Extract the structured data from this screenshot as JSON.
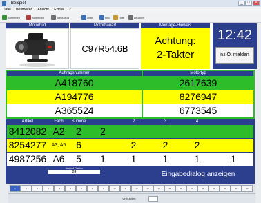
{
  "window": {
    "title": "Beispiel"
  },
  "menu": [
    "Datei",
    "Bearbeiten",
    "Ansicht",
    "Extras",
    "?"
  ],
  "toolbar": [
    {
      "label": "Anmelden",
      "icon": "login-icon",
      "color": "#3b8f3b"
    },
    {
      "label": "Abmelden",
      "icon": "logout-icon",
      "color": "#b23b3b"
    },
    {
      "label": "Werkzeug",
      "icon": "tool-icon",
      "color": "#6f6f6f"
    },
    {
      "label": "Liste",
      "icon": "list-icon",
      "color": "#3b6fb6"
    },
    {
      "label": "Info",
      "icon": "info-icon",
      "color": "#3b6fb6"
    },
    {
      "label": "Hilfe",
      "icon": "help-icon",
      "color": "#c69b2b"
    },
    {
      "label": "Drucken",
      "icon": "print-icon",
      "color": "#6f6f6f"
    }
  ],
  "headers": {
    "motorbild": "Motorbild",
    "motorbauart": "Motorbauart",
    "montage_hinweis": "Montage-Hinweis",
    "auftragsnummer": "Auftragsnummer",
    "motortyp": "Motortyp",
    "artikel": "Artikel",
    "fach": "Fach",
    "summe": "Summe",
    "col2": "2",
    "col3": "3",
    "col4": "4",
    "col5": "",
    "anzahl_faecher": "Anzahl Fächer"
  },
  "motorbauart": "C97R54.6B",
  "montage_hinweis": "Achtung:\n2-Takter",
  "clock": "12:42",
  "io_button": "n.i.O. melden",
  "orders": [
    {
      "auftrag": "A418760",
      "motortyp": "2617639",
      "color": "green"
    },
    {
      "auftrag": "A194776",
      "motortyp": "8276947",
      "color": "yellow"
    },
    {
      "auftrag": "A365524",
      "motortyp": "6773545",
      "color": "white"
    }
  ],
  "articles": [
    {
      "artikel": "8412082",
      "fach": "A2",
      "summe": "2",
      "c1": "2",
      "c2": "",
      "c3": "",
      "c4": "",
      "c5": "",
      "color": "green"
    },
    {
      "artikel": "8254277",
      "fach": "A3, A5",
      "summe": "6",
      "c1": "",
      "c2": "2",
      "c3": "2",
      "c4": "2",
      "c5": "",
      "color": "yellow"
    },
    {
      "artikel": "4987256",
      "fach": "A6",
      "summe": "5",
      "c1": "1",
      "c2": "1",
      "c3": "1",
      "c4": "1",
      "c5": "1",
      "color": "white"
    }
  ],
  "anzahl_faecher_value": "24",
  "eingabe_button": "Eingabedialog anzeigen",
  "status_buttons": [
    "1",
    "2",
    "3",
    "4",
    "5",
    "6",
    "7",
    "8",
    "9",
    "10",
    "11",
    "12",
    "13",
    "14",
    "15",
    "16",
    "17",
    "18",
    "19",
    "20",
    "21",
    "22"
  ],
  "status_footer": "verbunden"
}
